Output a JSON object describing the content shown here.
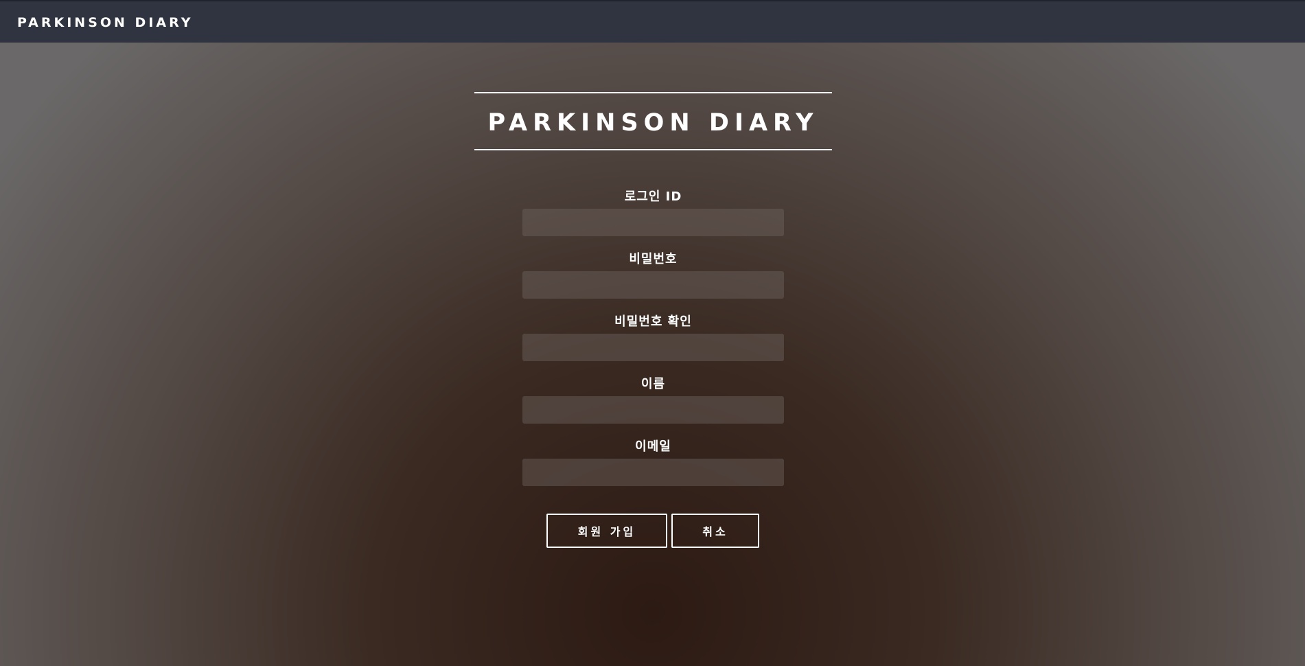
{
  "header": {
    "brand": "PARKINSON DIARY"
  },
  "hero": {
    "title": "PARKINSON DIARY"
  },
  "form": {
    "fields": [
      {
        "label": "로그인 ID",
        "value": ""
      },
      {
        "label": "비밀번호",
        "value": ""
      },
      {
        "label": "비밀번호 확인",
        "value": ""
      },
      {
        "label": "이름",
        "value": ""
      },
      {
        "label": "이메일",
        "value": ""
      }
    ],
    "signup_label": "회원 가입",
    "cancel_label": "취소"
  },
  "colors": {
    "topbar": "#2f3440",
    "text": "#ffffff",
    "background_center": "#2c1a13",
    "background_edge": "#6a6868"
  }
}
